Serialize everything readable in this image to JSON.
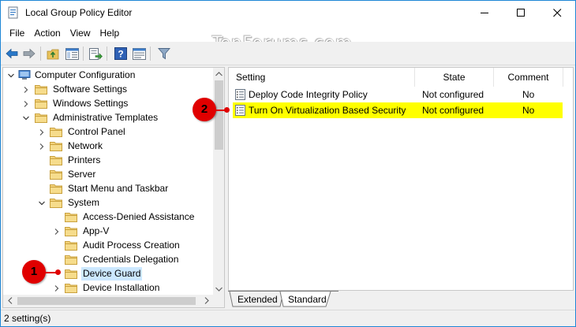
{
  "window": {
    "title": "Local Group Policy Editor",
    "accent_color": "#1e86d6"
  },
  "menubar": {
    "items": [
      "File",
      "Action",
      "View",
      "Help"
    ]
  },
  "watermark": "TenForums.com",
  "toolbar": {
    "icons": [
      "back-arrow-icon",
      "forward-arrow-icon",
      "up-folder-icon",
      "show-hide-tree-icon",
      "export-list-icon",
      "help-icon",
      "extended-view-icon",
      "filter-icon"
    ]
  },
  "tree": {
    "items": [
      {
        "label": "Computer Configuration",
        "depth": 0,
        "expander": "expanded",
        "icon": "computer-icon"
      },
      {
        "label": "Software Settings",
        "depth": 1,
        "expander": "collapsed",
        "icon": "folder-icon"
      },
      {
        "label": "Windows Settings",
        "depth": 1,
        "expander": "collapsed",
        "icon": "folder-icon"
      },
      {
        "label": "Administrative Templates",
        "depth": 1,
        "expander": "expanded",
        "icon": "folder-icon"
      },
      {
        "label": "Control Panel",
        "depth": 2,
        "expander": "collapsed",
        "icon": "folder-icon"
      },
      {
        "label": "Network",
        "depth": 2,
        "expander": "collapsed",
        "icon": "folder-icon"
      },
      {
        "label": "Printers",
        "depth": 2,
        "expander": "none",
        "icon": "folder-icon"
      },
      {
        "label": "Server",
        "depth": 2,
        "expander": "none",
        "icon": "folder-icon"
      },
      {
        "label": "Start Menu and Taskbar",
        "depth": 2,
        "expander": "none",
        "icon": "folder-icon"
      },
      {
        "label": "System",
        "depth": 2,
        "expander": "expanded",
        "icon": "folder-icon"
      },
      {
        "label": "Access-Denied Assistance",
        "depth": 3,
        "expander": "none",
        "icon": "folder-icon"
      },
      {
        "label": "App-V",
        "depth": 3,
        "expander": "collapsed",
        "icon": "folder-icon"
      },
      {
        "label": "Audit Process Creation",
        "depth": 3,
        "expander": "none",
        "icon": "folder-icon"
      },
      {
        "label": "Credentials Delegation",
        "depth": 3,
        "expander": "none",
        "icon": "folder-icon"
      },
      {
        "label": "Device Guard",
        "depth": 3,
        "expander": "none",
        "icon": "folder-icon",
        "selected": true
      },
      {
        "label": "Device Installation",
        "depth": 3,
        "expander": "collapsed",
        "icon": "folder-icon"
      }
    ]
  },
  "list": {
    "columns": [
      "Setting",
      "State",
      "Comment"
    ],
    "rows": [
      {
        "setting": "Deploy Code Integrity Policy",
        "state": "Not configured",
        "comment": "No",
        "highlighted": false
      },
      {
        "setting": "Turn On Virtualization Based Security",
        "state": "Not configured",
        "comment": "No",
        "highlighted": true
      }
    ],
    "highlight_color": "#ffff00"
  },
  "tabs": [
    {
      "label": "Extended",
      "active": false
    },
    {
      "label": "Standard",
      "active": true
    }
  ],
  "status": "2 setting(s)",
  "callouts": [
    {
      "number": "1",
      "color": "#e00000"
    },
    {
      "number": "2",
      "color": "#e00000"
    }
  ]
}
